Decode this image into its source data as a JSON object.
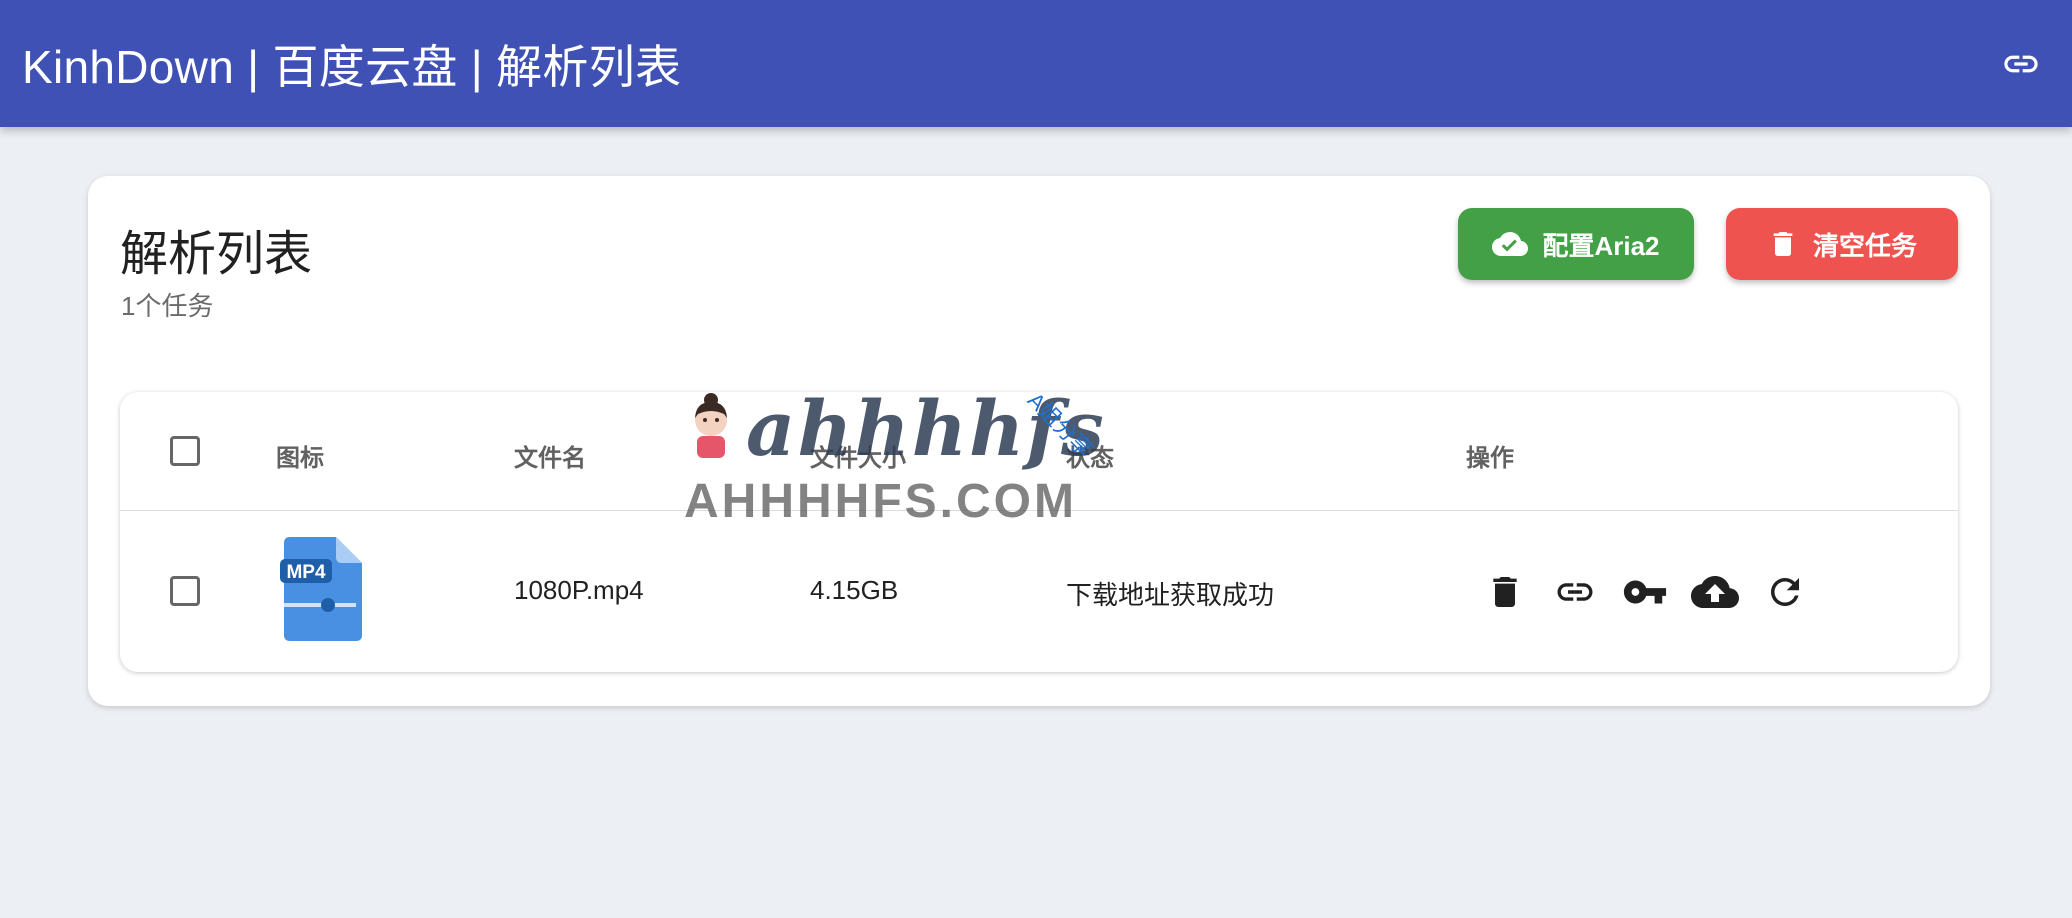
{
  "appbar": {
    "title": "KinhDown | 百度云盘 | 解析列表",
    "link_icon": "link-icon"
  },
  "card": {
    "title": "解析列表",
    "subtitle": "1个任务",
    "buttons": {
      "aria2_label": "配置Aria2",
      "clear_label": "清空任务"
    }
  },
  "table": {
    "headers": {
      "icon": "图标",
      "filename": "文件名",
      "size": "文件大小",
      "status": "状态",
      "actions": "操作"
    },
    "rows": [
      {
        "file_type": "MP4",
        "filename": "1080P.mp4",
        "size": "4.15GB",
        "status": "下载地址获取成功"
      }
    ]
  },
  "watermark": {
    "main": "ahhhhfs",
    "side": "A姐分享",
    "url": "AHHHHFS.COM"
  },
  "colors": {
    "appbar": "#3f51b5",
    "aria2_button": "#43a047",
    "clear_button": "#ef5350",
    "background": "#eceff4",
    "file_icon": "#4a90e2"
  }
}
